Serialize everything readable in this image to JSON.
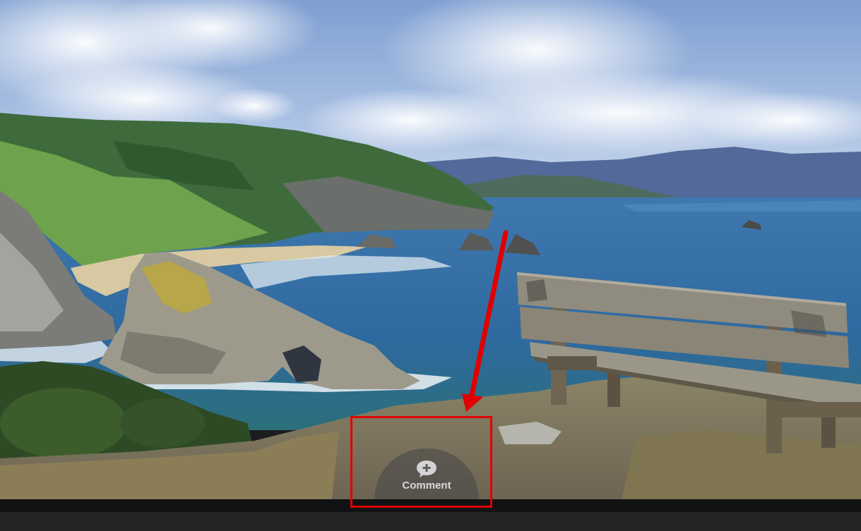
{
  "comment_button": {
    "label": "Comment",
    "icon": "comment-add-icon"
  },
  "annotation": {
    "color": "#e00000"
  },
  "colors": {
    "bar": "#111213",
    "bar_strip": "#232426"
  }
}
